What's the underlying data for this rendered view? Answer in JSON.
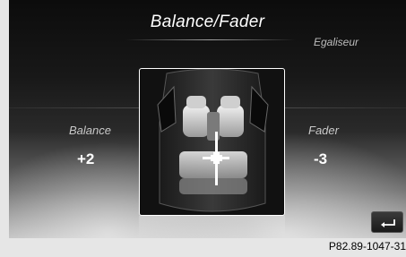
{
  "screen": {
    "title": "Balance/Fader",
    "side_tab": "Egaliseur",
    "balance": {
      "label": "Balance",
      "value": "+2"
    },
    "fader": {
      "label": "Fader",
      "value": "-3"
    },
    "car_view": {
      "icon": "car-top-view-icon",
      "crosshair_icon": "crosshair-icon"
    },
    "back_button": {
      "icon": "back-arrow-icon"
    }
  },
  "caption": "P82.89-1047-31"
}
